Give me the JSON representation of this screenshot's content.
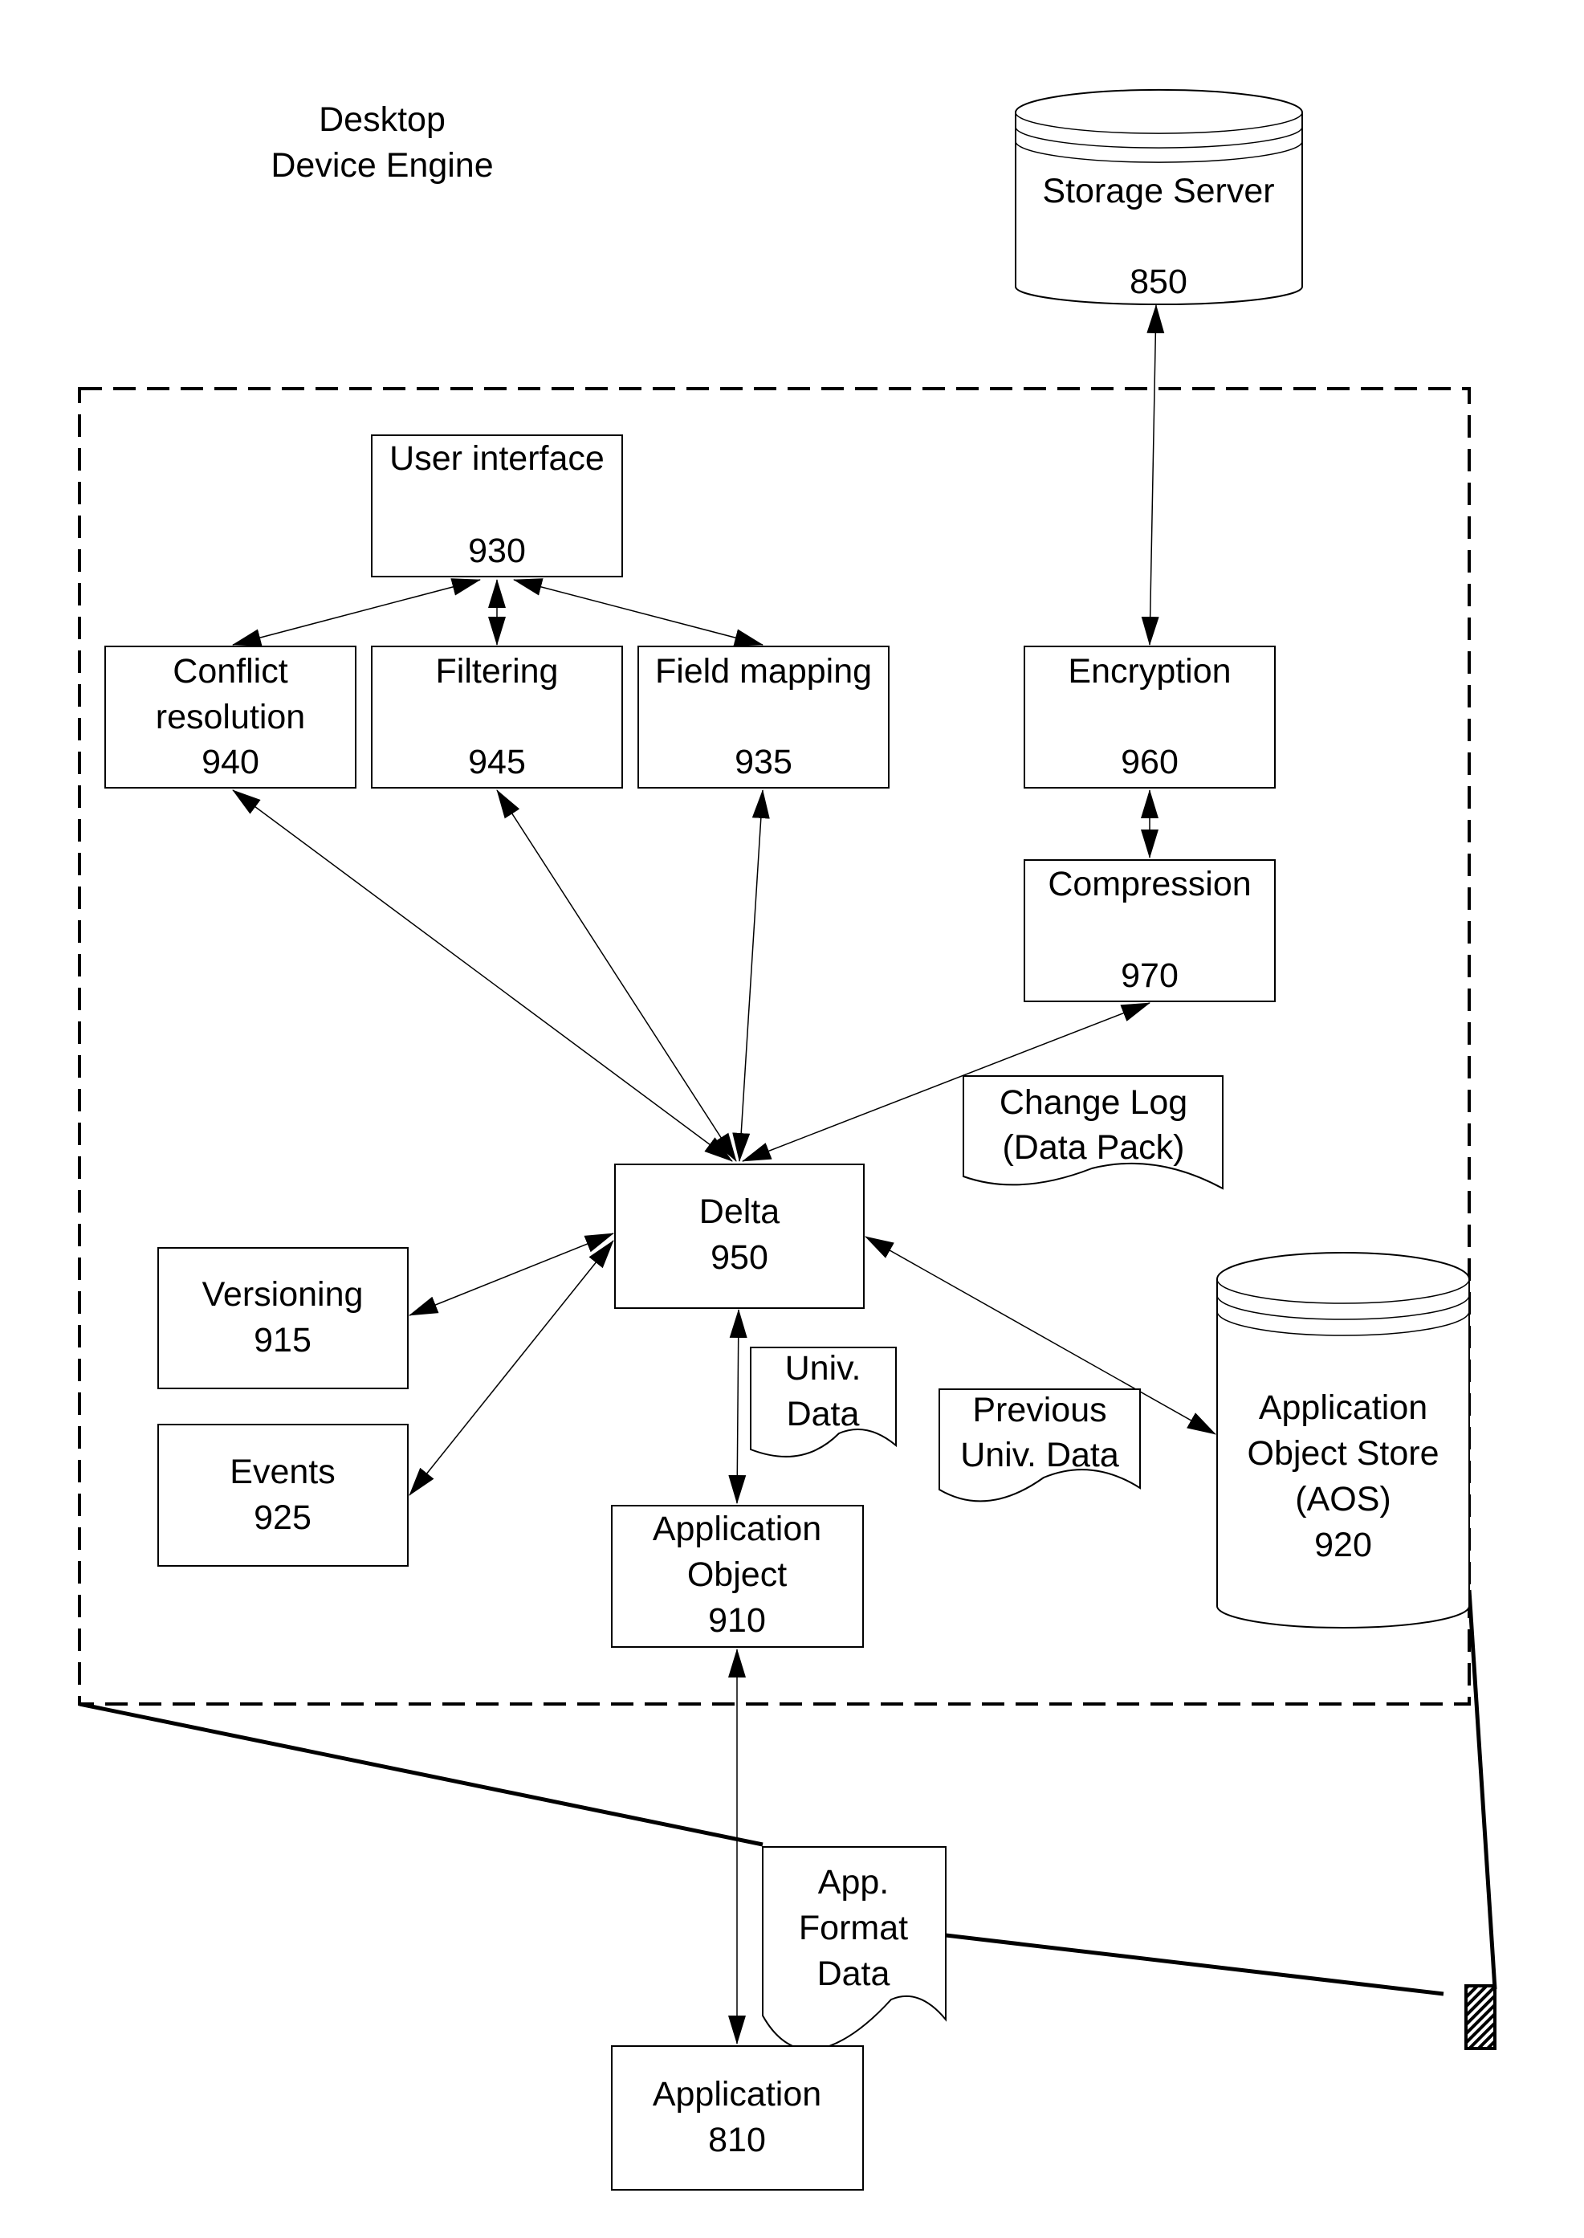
{
  "title": [
    "Desktop",
    "Device Engine"
  ],
  "nodes": {
    "storage_server": {
      "lines": [
        "Storage Server",
        "",
        "850"
      ]
    },
    "user_interface": {
      "lines": [
        "User interface",
        "",
        "930"
      ]
    },
    "conflict_resolution": {
      "lines": [
        "Conflict",
        "resolution",
        "940"
      ]
    },
    "filtering": {
      "lines": [
        "Filtering",
        "",
        "945"
      ]
    },
    "field_mapping": {
      "lines": [
        "Field mapping",
        "",
        "935"
      ]
    },
    "encryption": {
      "lines": [
        "Encryption",
        "",
        "960"
      ]
    },
    "compression": {
      "lines": [
        "Compression",
        "",
        "970"
      ]
    },
    "change_log": {
      "lines": [
        "Change Log",
        "(Data Pack)"
      ]
    },
    "delta": {
      "lines": [
        "Delta",
        "950"
      ]
    },
    "versioning": {
      "lines": [
        "Versioning",
        "915"
      ]
    },
    "events": {
      "lines": [
        "Events",
        "925"
      ]
    },
    "univ_data": {
      "lines": [
        "Univ.",
        "Data"
      ]
    },
    "previous_univ_data": {
      "lines": [
        "Previous",
        "Univ. Data"
      ]
    },
    "aos": {
      "lines": [
        "Application",
        "Object Store",
        "(AOS)",
        "920"
      ]
    },
    "application_object": {
      "lines": [
        "Application",
        "Object",
        "910"
      ]
    },
    "app_format_data": {
      "lines": [
        "App.",
        "Format",
        "Data"
      ]
    },
    "application": {
      "lines": [
        "Application",
        "810"
      ]
    }
  },
  "edges": [
    {
      "from": "storage_server",
      "to": "encryption",
      "type": "bidirectional"
    },
    {
      "from": "user_interface",
      "to": "conflict_resolution",
      "type": "bidirectional"
    },
    {
      "from": "user_interface",
      "to": "filtering",
      "type": "bidirectional"
    },
    {
      "from": "user_interface",
      "to": "field_mapping",
      "type": "bidirectional"
    },
    {
      "from": "encryption",
      "to": "compression",
      "type": "bidirectional"
    },
    {
      "from": "compression",
      "to": "delta",
      "type": "bidirectional"
    },
    {
      "from": "conflict_resolution",
      "to": "delta",
      "type": "bidirectional"
    },
    {
      "from": "filtering",
      "to": "delta",
      "type": "bidirectional"
    },
    {
      "from": "field_mapping",
      "to": "delta",
      "type": "bidirectional"
    },
    {
      "from": "delta",
      "to": "versioning",
      "type": "bidirectional"
    },
    {
      "from": "delta",
      "to": "events",
      "type": "bidirectional"
    },
    {
      "from": "delta",
      "to": "application_object",
      "type": "bidirectional"
    },
    {
      "from": "delta",
      "to": "aos",
      "type": "bidirectional"
    },
    {
      "from": "application_object",
      "to": "application",
      "type": "bidirectional"
    }
  ]
}
